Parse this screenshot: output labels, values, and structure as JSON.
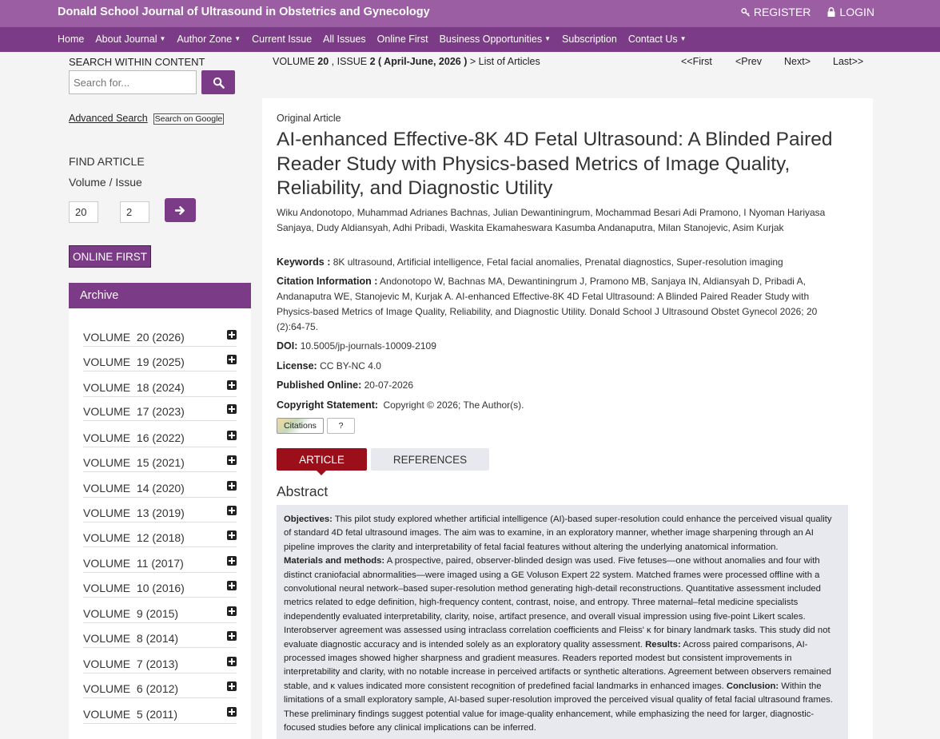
{
  "header": {
    "brand": "Donald School Journal of Ultrasound in Obstetrics and Gynecology",
    "register": "REGISTER",
    "login": "LOGIN"
  },
  "nav": [
    {
      "label": "Home",
      "dropdown": false
    },
    {
      "label": "About Journal",
      "dropdown": true
    },
    {
      "label": "Author Zone",
      "dropdown": true
    },
    {
      "label": "Current Issue",
      "dropdown": false
    },
    {
      "label": "All Issues",
      "dropdown": false
    },
    {
      "label": "Online First",
      "dropdown": false
    },
    {
      "label": "Business Opportunities",
      "dropdown": true
    },
    {
      "label": "Subscription",
      "dropdown": false
    },
    {
      "label": "Contact Us",
      "dropdown": true
    }
  ],
  "sidebar": {
    "search_label": "SEARCH WITHIN CONTENT",
    "search_placeholder": "Search for...",
    "advanced_search": "Advanced Search",
    "google_search": "Search on Google",
    "find_article": "FIND ARTICLE",
    "volume_issue_label": "Volume / Issue",
    "volume_value": "20",
    "issue_value": "2",
    "online_first": "ONLINE FIRST",
    "archive_title": "Archive",
    "archive": [
      "VOLUME  20 (2026)",
      "VOLUME  19 (2025)",
      "VOLUME  18 (2024)",
      "VOLUME  17 (2023)",
      "VOLUME  16 (2022)",
      "VOLUME  15 (2021)",
      "VOLUME  14 (2020)",
      "VOLUME  13 (2019)",
      "VOLUME  12 (2018)",
      "VOLUME  11 (2017)",
      "VOLUME  10 (2016)",
      "VOLUME  9 (2015)",
      "VOLUME  8 (2014)",
      "VOLUME  7 (2013)",
      "VOLUME  6 (2012)",
      "VOLUME  5 (2011)"
    ]
  },
  "issue_bar": {
    "volume_prefix": "VOLUME ",
    "volume": "20",
    "issue_prefix": " , ISSUE ",
    "issue": "2",
    "date": " ( April-June, 2026 )",
    "suffix": " > List of Articles",
    "first": "<<First",
    "prev": "<Prev",
    "next": "Next>",
    "last": "Last>>"
  },
  "article": {
    "type": "Original Article",
    "title": "AI-enhanced Effective-8K 4D Fetal Ultrasound: A Blinded Paired Reader Study with Physics-based Metrics of Image Quality, Reliability, and Diagnostic Utility",
    "authors": "Wiku Andonotopo, Muhammad Adrianes Bachnas, Julian Dewantiningrum, Mochammad Besari Adi Pramono, I Nyoman Hariyasa Sanjaya, Dudy Aldiansyah, Adhi Pribadi, Waskita Ekamaheswara Kasumba Andanaputra, Milan Stanojevic, Asim Kurjak",
    "keywords_label": "Keywords :",
    "keywords": "8K ultrasound, Artificial intelligence, Fetal facial anomalies, Prenatal diagnostics, Super-resolution imaging",
    "citation_label": "Citation Information :",
    "citation": "Andonotopo W, Bachnas MA, Dewantiningrum J, Pramono MB, Sanjaya IN, Aldiansyah D, Pribadi A, Andanaputra WE, Stanojevic M, Kurjak A. AI-enhanced Effective-8K 4D Fetal Ultrasound: A Blinded Paired Reader Study with Physics-based Metrics of Image Quality, Reliability, and Diagnostic Utility. Donald School J Ultrasound Obstet Gynecol 2026; 20 (2):64-75.",
    "doi_label": "DOI:",
    "doi": "10.5005/jp-journals-10009-2109",
    "license_label": "License:",
    "license": "CC BY-NC 4.0",
    "published_label": "Published Online:",
    "published": "20-07-2026",
    "copyright_label": "Copyright Statement:",
    "copyright": "Copyright © 2026; The Author(s).",
    "citations_badge": "Citations",
    "citations_count": "?",
    "tab_article": "ARTICLE",
    "tab_references": "REFERENCES",
    "abstract_heading": "Abstract",
    "abstract": {
      "objectives_label": "Objectives:",
      "objectives": "This pilot study explored whether artificial intelligence (AI)-based super-resolution could enhance the perceived visual quality of standard 4D fetal ultrasound images. The aim was to examine, in an exploratory manner, whether image sharpening through an AI pipeline improves the clarity and interpretability of fetal facial features without altering the underlying anatomical information.",
      "methods_label": "Materials and methods:",
      "methods": "A prospective, paired, observer-blinded design was used. Five fetuses—one without anomalies and four with distinct craniofacial abnormalities—were imaged using a GE Voluson Expert 22 system. Matched frames were processed offline with a convolutional neural network–based super-resolution method generating high-detail reconstructions. Quantitative assessment included metrics related to edge definition, high-frequency content, contrast, noise, and entropy. Three maternal–fetal medicine specialists independently evaluated interpretability, clarity, noise, artifact presence, and overall visual impression using five-point Likert scales. Interobserver agreement was assessed using intraclass correlation coefficients and Fleiss' κ for binary landmark tasks. This study did not evaluate diagnostic accuracy and is intended solely as an exploratory quality assessment.",
      "results_label": "Results:",
      "results": "Across paired comparisons, AI-processed images showed higher sharpness and gradient measures. Readers reported modest but consistent improvements in interpretability and clarity, with no notable increase in perceived artifacts or synthetic alterations. Agreement between observers remained stable, and κ values indicated more consistent recognition of predefined facial landmarks in enhanced images.",
      "conclusion_label": "Conclusion:",
      "conclusion": "Within the limitations of a small exploratory sample, AI-based super-resolution improved the perceived visual quality of fetal facial ultrasound frames. These preliminary findings suggest potential value for image-quality enhancement, while emphasizing the need for larger, diagnostic-focused studies before any clinical implications can be inferred."
    }
  }
}
